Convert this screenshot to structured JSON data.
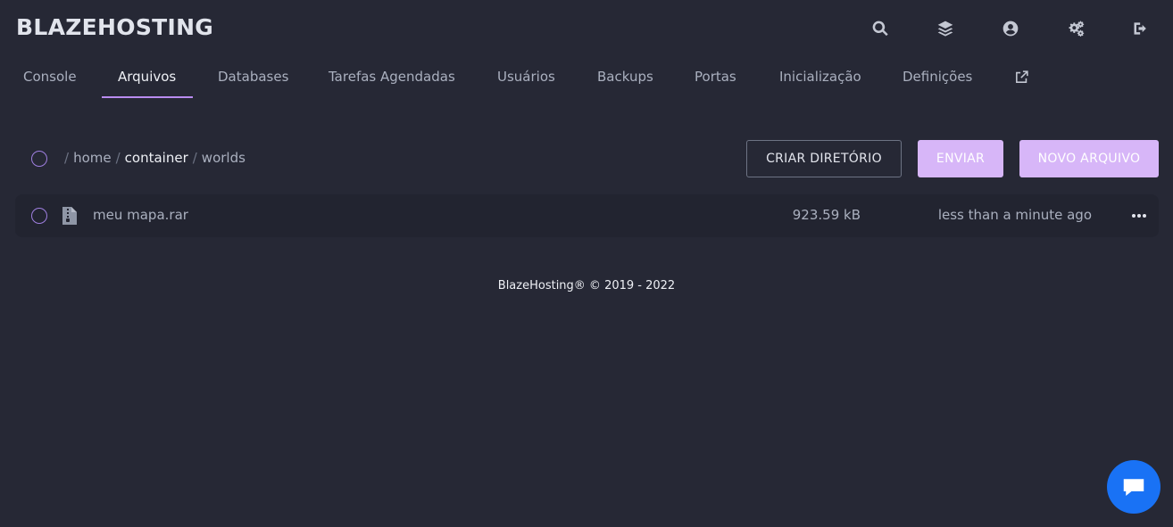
{
  "app": {
    "brand": "BLAZEHOSTING"
  },
  "top_icons": [
    "search-icon",
    "layers-icon",
    "user-circle-icon",
    "cogs-icon",
    "logout-icon"
  ],
  "tabs": [
    {
      "label": "Console",
      "active": false
    },
    {
      "label": "Arquivos",
      "active": true
    },
    {
      "label": "Databases",
      "active": false
    },
    {
      "label": "Tarefas Agendadas",
      "active": false
    },
    {
      "label": "Usuários",
      "active": false
    },
    {
      "label": "Backups",
      "active": false
    },
    {
      "label": "Portas",
      "active": false
    },
    {
      "label": "Inicialização",
      "active": false
    },
    {
      "label": "Definições",
      "active": false
    }
  ],
  "breadcrumb": {
    "sep": "/",
    "items": [
      "home",
      "container",
      "worlds"
    ]
  },
  "actions": {
    "create_dir": "Criar Diretório",
    "upload": "Enviar",
    "new_file": "Novo Arquivo"
  },
  "files": [
    {
      "name": "meu mapa.rar",
      "size": "923.59 kB",
      "modified": "less than a minute ago"
    }
  ],
  "footer": "BlazeHosting® © 2019 - 2022",
  "colors": {
    "background": "#262835",
    "accent": "#b98cf0",
    "primary_button": "#d7b6f8",
    "chat_button": "#1972f5"
  }
}
